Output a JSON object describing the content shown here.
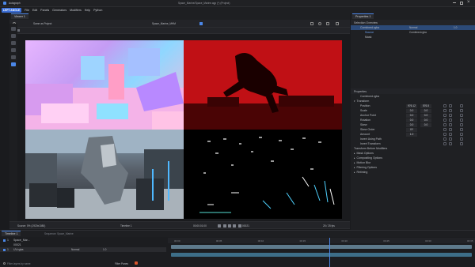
{
  "titlebar": {
    "app": "Autograph",
    "document": "Space_Marine/Space_Marine.agp (*) (Project)"
  },
  "menu": {
    "logo": "LEFT ANGLE",
    "items": [
      "File",
      "Edit",
      "Panels",
      "Generators",
      "Modifiers",
      "Help",
      "Python"
    ]
  },
  "viewer": {
    "tab": "Viewer 1",
    "scene_selector": "Same as Project",
    "comp_name": "Space_Marine_MHM",
    "overlays": {
      "quad1": "uv",
      "quad2": "matte",
      "quad3": "beauty",
      "quad4": "lights"
    },
    "colors": {
      "matte_red": "#c40f14",
      "viewer_bg": "#000000"
    },
    "footer": {
      "zoom": "Source: 0% (1920x1080)",
      "composition": "Timeline 1",
      "timecode": "00:00:01:00",
      "frame": "00021",
      "fps": "25 / 25 fps"
    }
  },
  "properties": {
    "tab": "Properties 1",
    "selection_header": "Selection Overview",
    "layers": [
      {
        "name": "Combined.rgba",
        "mode": "Normal",
        "value": "1.0"
      },
      {
        "name": "Source",
        "mode": "Combined.rgba"
      },
      {
        "name": "Mask"
      }
    ],
    "section": "Properties",
    "object": "Combined.rgba",
    "group": "Transform",
    "rows": [
      {
        "label": "Position",
        "v1": "976.12",
        "v2": "576.5"
      },
      {
        "label": "Scale",
        "v1": "0.0",
        "v2": "0.0"
      },
      {
        "label": "Anchor Point",
        "v1": "0.0",
        "v2": "0.0"
      },
      {
        "label": "Rotation",
        "v1": "0.0",
        "v2": "0.0"
      },
      {
        "label": "Skew",
        "v1": "0.0",
        "v2": "0.0"
      },
      {
        "label": "Skew Order",
        "v1": "XY",
        "v2": ""
      },
      {
        "label": "Amount",
        "v1": "1.0",
        "v2": ""
      },
      {
        "label": "Invert Using Path",
        "v1": "",
        "v2": ""
      },
      {
        "label": "Invert Transform",
        "v1": "",
        "v2": ""
      }
    ],
    "after_transform": "Transform Before Modifiers",
    "collapsed_groups": [
      "Mask Options",
      "Compositing Options",
      "Motion Blur",
      "Filtering Options",
      "Retiming"
    ]
  },
  "timeline": {
    "tab": "Timeline 1",
    "comp_tab": "Sequence: Space_Marine",
    "layers": [
      {
        "name": "Space_Mar...",
        "num": "1"
      },
      {
        "name": "00021",
        "num": ""
      },
      {
        "name": "UV.rgba",
        "num": "1"
      }
    ],
    "blend_mode": "Normal",
    "opacity": "1.0",
    "search_placeholder": "Filter layers by name",
    "filter_label": "Filter Panes",
    "ruler": [
      "00:00",
      "00:05",
      "00:10",
      "00:15",
      "00:20",
      "00:25",
      "00:30",
      "00:35"
    ],
    "colors": {
      "track": "#3d6e88",
      "playhead": "#4b87e8"
    }
  }
}
